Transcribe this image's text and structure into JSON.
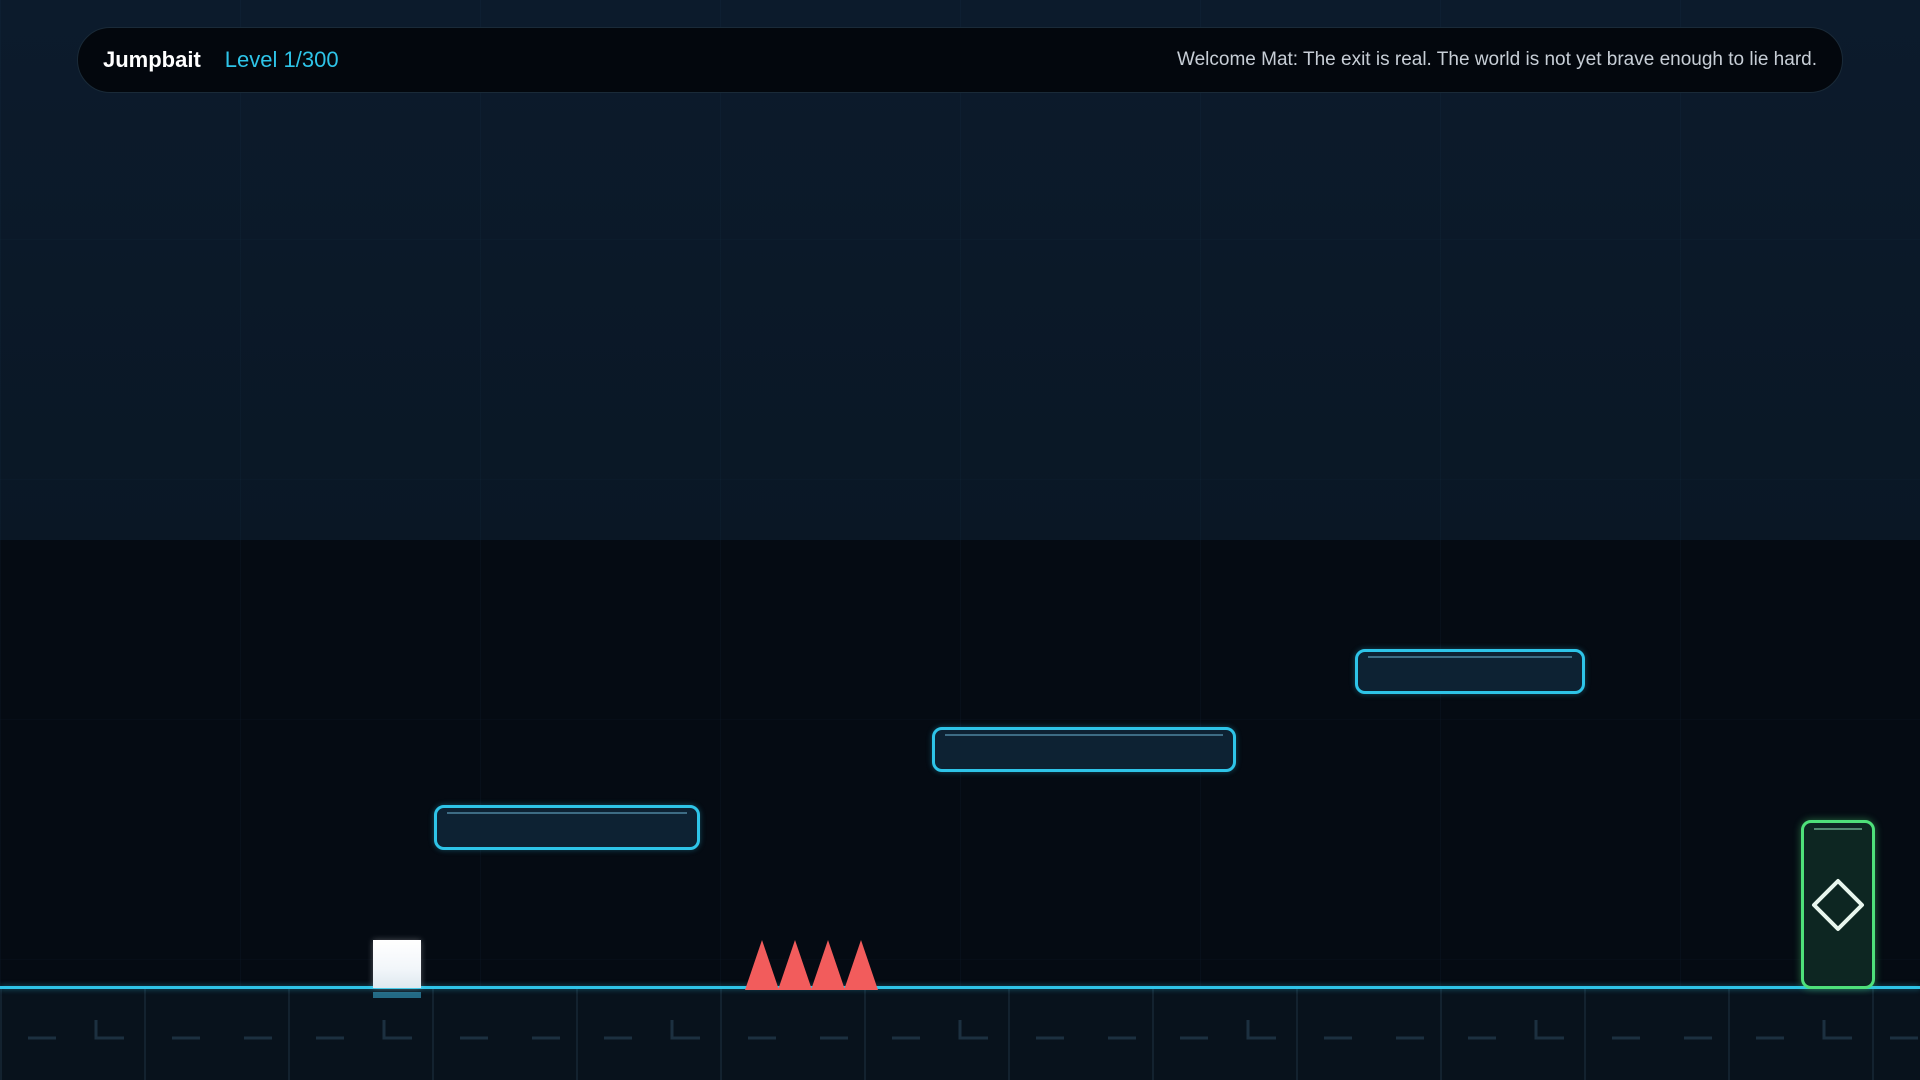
{
  "hud": {
    "title": "Jumpbait",
    "level": "Level 1/300",
    "message": "Welcome Mat: The exit is real. The world is not yet brave enough to lie hard."
  },
  "colors": {
    "accent": "#2ec4e8",
    "spike": "#f25c5c",
    "exit": "#4ee07a",
    "player": "#ffffff",
    "background": "#0a1624"
  },
  "icons": {
    "exit": "diamond-icon"
  }
}
